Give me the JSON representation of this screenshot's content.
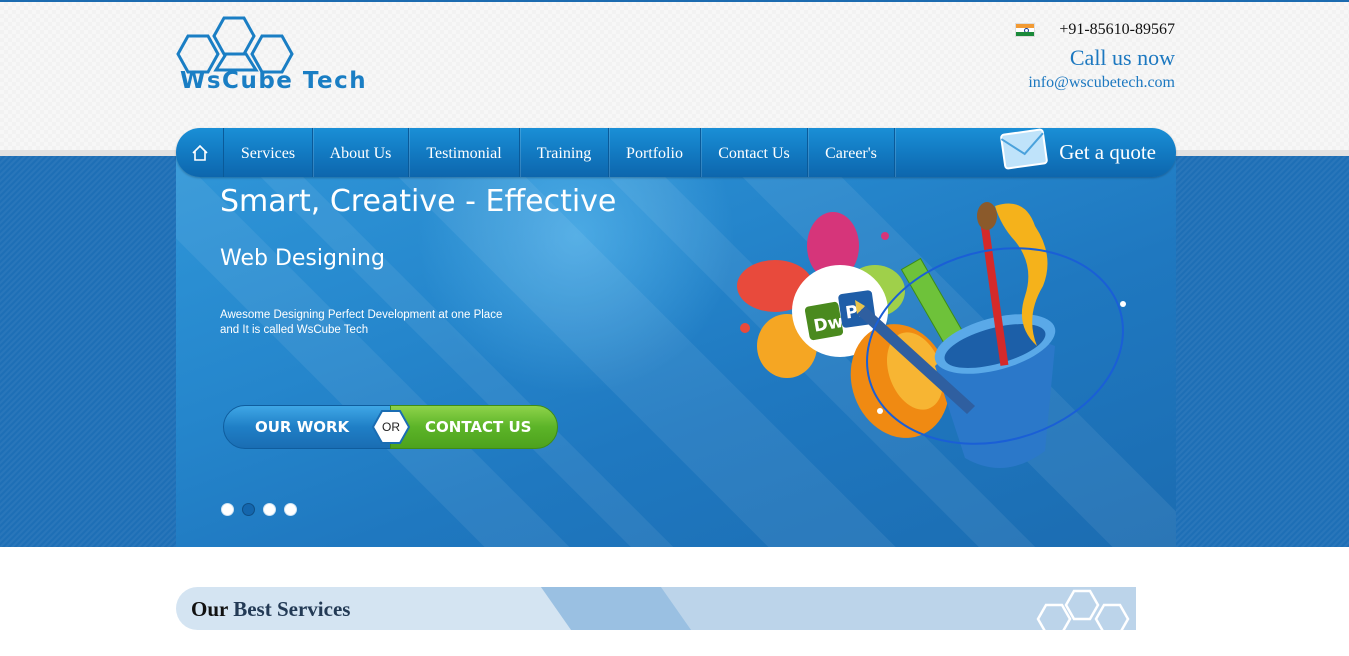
{
  "logo": {
    "text": "WsCube Tech"
  },
  "contact": {
    "phone": "+91-85610-89567",
    "call_label": "Call us now",
    "email": "info@wscubetech.com"
  },
  "nav": {
    "items": [
      {
        "label": "Services"
      },
      {
        "label": "About Us"
      },
      {
        "label": "Testimonial"
      },
      {
        "label": "Training"
      },
      {
        "label": "Portfolio"
      },
      {
        "label": "Contact Us"
      },
      {
        "label": "Career's"
      }
    ],
    "quote_label": "Get a quote"
  },
  "hero": {
    "title": "Smart, Creative - Effective",
    "subtitle": "Web Designing",
    "description_line1": "Awesome Designing Perfect Development at one Place",
    "description_line2": "and It is called WsCube Tech",
    "work_button": "OUR WORK",
    "or_label": "OR",
    "contact_button": "CONTACT US",
    "slides_total": 4,
    "slide_active": 2
  },
  "services": {
    "title_bold": "Our",
    "title_rest": "Best Services"
  },
  "icons": [
    "home-icon",
    "envelope-icon",
    "india-flag-icon",
    "hexagon-logo-icon"
  ],
  "colors": {
    "brand_blue": "#1c78c0",
    "nav_blue": "#137cc4",
    "green": "#5cb428"
  }
}
